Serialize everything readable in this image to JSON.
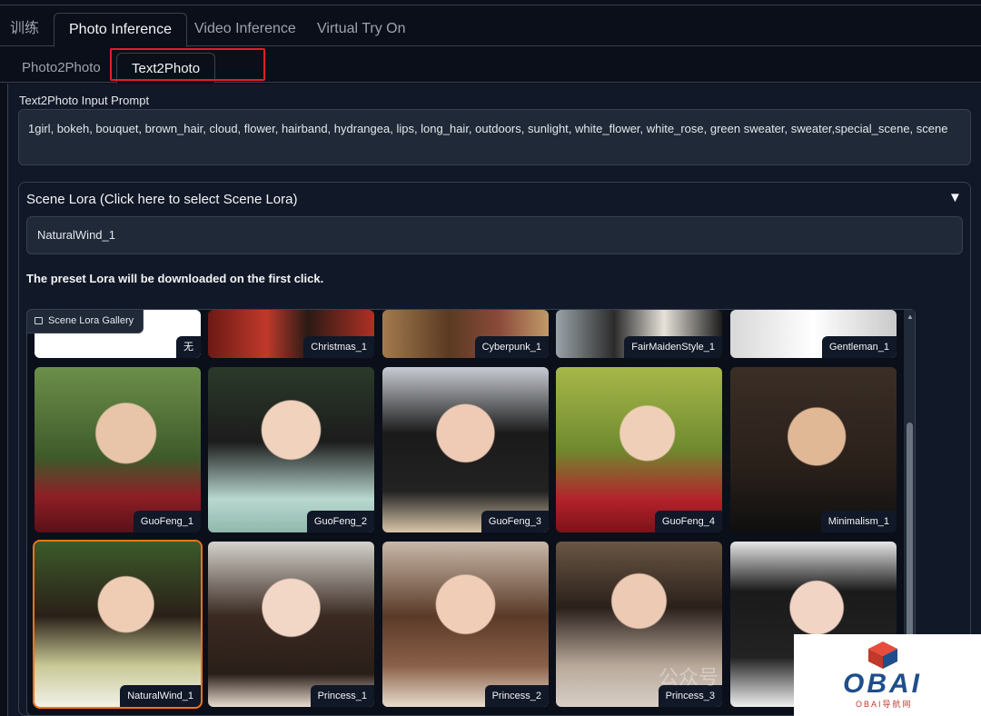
{
  "main_tabs": [
    "训练",
    "Photo Inference",
    "Video Inference",
    "Virtual Try On"
  ],
  "sub_tabs": [
    "Photo2Photo",
    "Text2Photo"
  ],
  "prompt": {
    "label": "Text2Photo Input Prompt",
    "value": "1girl, bokeh, bouquet, brown_hair, cloud, flower, hairband, hydrangea, lips, long_hair, outdoors, sunlight, white_flower, white_rose, green sweater, sweater,special_scene, scene"
  },
  "scene_lora": {
    "title": "Scene Lora (Click here to select Scene Lora)",
    "arrow": "▼",
    "value": "NaturalWind_1",
    "notice": "The preset Lora will be downloaded on the first click."
  },
  "gallery": {
    "label": "Scene Lora Gallery",
    "row1": [
      "无",
      "Christmas_1",
      "Cyberpunk_1",
      "FairMaidenStyle_1",
      "Gentleman_1"
    ],
    "row2": [
      "GuoFeng_1",
      "GuoFeng_2",
      "GuoFeng_3",
      "GuoFeng_4",
      "Minimalism_1"
    ],
    "row3": [
      "NaturalWind_1",
      "Princess_1",
      "Princess_2",
      "Princess_3",
      ""
    ],
    "selected": "NaturalWind_1"
  },
  "watermark": {
    "text": "公众号",
    "logo": "OBAI",
    "logo_sub": "OBAI导航网"
  },
  "colors": {
    "background": "#0b0f19",
    "panel": "#111827",
    "selected_outline": "#f97316",
    "highlight_box": "#e11d2e"
  }
}
